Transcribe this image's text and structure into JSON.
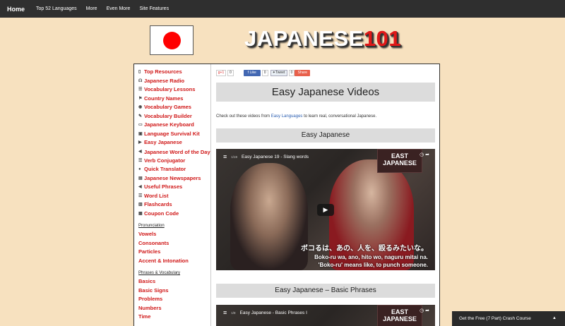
{
  "nav": {
    "home": "Home",
    "items": [
      "Top 52 Languages",
      "More",
      "Even More",
      "Site Features"
    ]
  },
  "header": {
    "logo_text": "JAPANESE",
    "logo_num": "101"
  },
  "sidebar": {
    "items": [
      {
        "icon": "bookmark-icon",
        "label": "Top Resources"
      },
      {
        "icon": "headphones-icon",
        "label": "Japanese Radio"
      },
      {
        "icon": "list-icon",
        "label": "Vocabulary Lessons"
      },
      {
        "icon": "flag-icon",
        "label": "Country Names"
      },
      {
        "icon": "gamepad-icon",
        "label": "Vocabulary Games"
      },
      {
        "icon": "edit-icon",
        "label": "Vocabulary Builder"
      },
      {
        "icon": "keyboard-icon",
        "label": "Japanese Keyboard"
      },
      {
        "icon": "camera-icon",
        "label": "Language Survival Kit"
      },
      {
        "icon": "video-icon",
        "label": "Easy Japanese"
      },
      {
        "icon": "volume-icon",
        "label": "Japanese Word of the Day"
      },
      {
        "icon": "list-icon",
        "label": "Verb Conjugator"
      },
      {
        "icon": "comment-icon",
        "label": "Quick Translator"
      },
      {
        "icon": "file-icon",
        "label": "Japanese Newspapers"
      },
      {
        "icon": "volume-icon",
        "label": "Useful Phrases"
      },
      {
        "icon": "list-icon",
        "label": "Word List"
      },
      {
        "icon": "book-icon",
        "label": "Flashcards"
      },
      {
        "icon": "ticket-icon",
        "label": "Coupon Code"
      }
    ],
    "section_pronunciation": "Pronunciation",
    "pronunciation": [
      "Vowels",
      "Consonants",
      "Particles",
      "Accent & Intonation"
    ],
    "section_phrases": "Phrases & Vocabulary",
    "phrases": [
      "Basics",
      "Basic Signs",
      "Problems",
      "Numbers",
      "Time"
    ]
  },
  "share": {
    "gplus_label": "g+1",
    "gplus_count": "0",
    "fb_label": "Like",
    "fb_count": "0",
    "tw_label": "Tweet",
    "tw_count": "0",
    "share_label": "Share"
  },
  "main": {
    "title": "Easy Japanese Videos",
    "intro_before": "Check out these videos from ",
    "intro_link": "Easy Languages",
    "intro_after": " to learn real, conversational Japanese.",
    "section1": "Easy Japanese",
    "section2": "Easy Japanese – Basic Phrases"
  },
  "video1": {
    "index": "1/19",
    "title": "Easy Japanese 19 - Slang words",
    "sign_line1": "EAST",
    "sign_line2": "JAPANESE",
    "sub_jp": "ボコるは、あの、人を、殴るみたいな。",
    "sub_romaji": "Boko-ru wa, ano, hito wo, naguru mitai na.",
    "sub_en": "'Boko-ru' means like, to punch someone."
  },
  "video2": {
    "index": "1/8",
    "title": "Easy Japanese - Basic Phrases I",
    "sign_line1": "EAST",
    "sign_line2": "JAPANESE"
  },
  "crash_course": "Get the Free (7 Part) Crash Course"
}
